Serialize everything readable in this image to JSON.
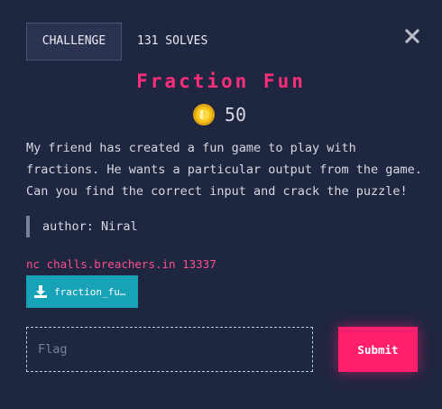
{
  "header": {
    "challenge_tab": "CHALLENGE",
    "solves_tab": "131 SOLVES",
    "close_icon": "close-icon"
  },
  "challenge": {
    "title": "Fraction Fun",
    "points": "50",
    "points_icon": "coin-icon",
    "description": "My friend has created a fun game to play with fractions. He wants a particular output from the game. Can you find the correct input and crack the puzzle!",
    "author": "author: Niral",
    "connection": "nc challs.breachers.in 13337",
    "file_label": "fraction_fu…"
  },
  "form": {
    "flag_placeholder": "Flag",
    "flag_value": "",
    "submit_label": "Submit"
  },
  "colors": {
    "background": "#1f2640",
    "accent_pink": "#ff1f6d",
    "title_pink": "#ff2d7a",
    "download_teal": "#17a2b8",
    "coin_gold": "#f5c518"
  }
}
